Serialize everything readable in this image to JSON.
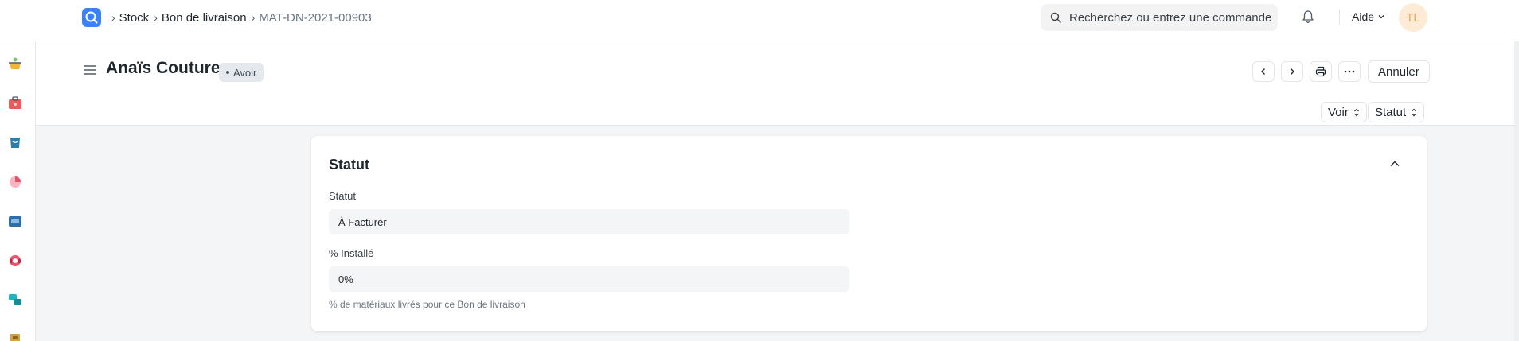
{
  "navbar": {
    "breadcrumbs": [
      {
        "label": "Stock"
      },
      {
        "label": "Bon de livraison"
      },
      {
        "label": "MAT-DN-2021-00903"
      }
    ],
    "search_placeholder": "Recherchez ou entrez une commande",
    "help_label": "Aide",
    "avatar_initials": "TL"
  },
  "page": {
    "title": "Anaïs Couture",
    "status_badge": "Avoir",
    "cancel_label": "Annuler",
    "view_select": "Voir",
    "status_select": "Statut"
  },
  "section": {
    "title": "Statut",
    "fields": [
      {
        "label": "Statut",
        "value": "À Facturer"
      },
      {
        "label": "% Installé",
        "value": "0%"
      }
    ],
    "description": "% de matériaux livrés pour ce Bon de livraison"
  },
  "colors": {
    "accent": "#3b82f6",
    "avatar_bg": "#fdebd5",
    "avatar_text": "#e8a85c"
  }
}
